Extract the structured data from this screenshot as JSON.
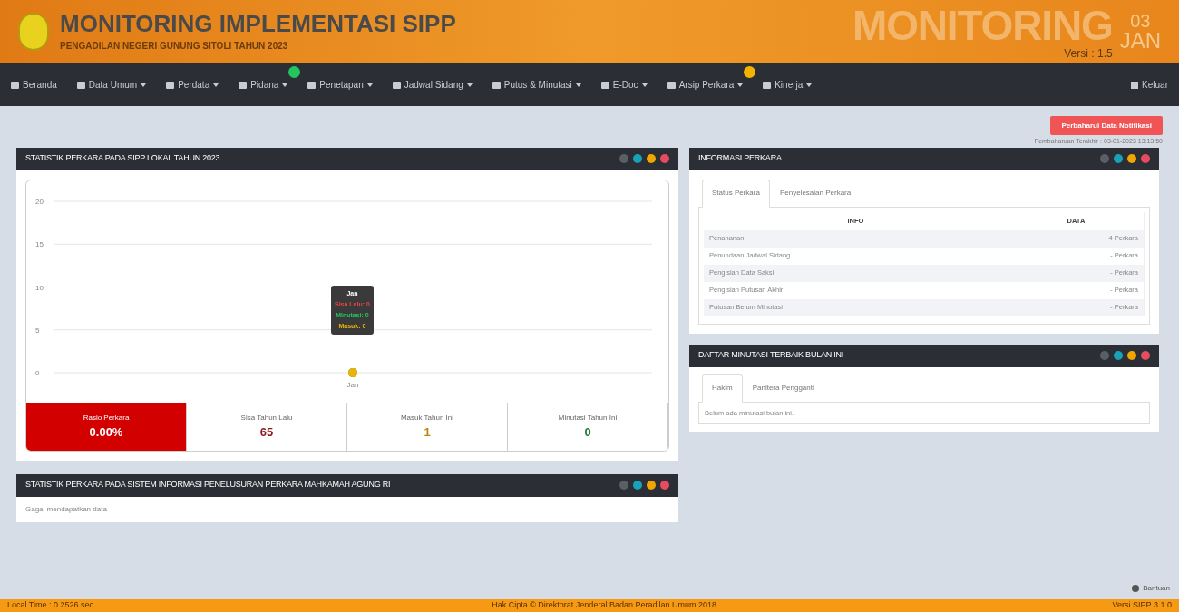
{
  "header": {
    "title": "MONITORING IMPLEMENTASI SIPP",
    "subtitle": "PENGADILAN NEGERI GUNUNG SITOLI TAHUN 2023",
    "banner": "MONITORING",
    "day": "03",
    "month": "JAN",
    "version": "Versi : 1.5"
  },
  "nav": {
    "items": [
      {
        "label": "Beranda",
        "dropdown": false
      },
      {
        "label": "Data Umum",
        "dropdown": true
      },
      {
        "label": "Perdata",
        "dropdown": true
      },
      {
        "label": "Pidana",
        "dropdown": true,
        "color": "#22c55e"
      },
      {
        "label": "Penetapan",
        "dropdown": true
      },
      {
        "label": "Jadwal Sidang",
        "dropdown": true
      },
      {
        "label": "Putus & Minutasi",
        "dropdown": true
      },
      {
        "label": "E-Doc",
        "dropdown": true
      },
      {
        "label": "Arsip Perkara",
        "dropdown": true,
        "color": "#f5b301"
      },
      {
        "label": "Kinerja",
        "dropdown": true
      }
    ],
    "logout": "Keluar"
  },
  "update_button": "Perbaharui Data Notifikasi",
  "last_update": "Pembaharuan Terakhir : 03-01-2023 13:13:50",
  "stat_panel": {
    "title": "STATISTIK PERKARA PADA SIPP LOKAL TAHUN 2023",
    "chart_data": {
      "type": "line",
      "categories": [
        "Jan"
      ],
      "yticks": [
        0,
        5,
        10,
        15,
        20
      ],
      "ylim": [
        0,
        20
      ],
      "grid": true,
      "series": [
        {
          "color": "#ef4444",
          "values": [
            0
          ],
          "marker": true
        },
        {
          "color": "#22c55e",
          "values": [
            0
          ],
          "marker": true
        },
        {
          "color": "#eab308",
          "values": [
            0
          ],
          "marker": true
        }
      ]
    },
    "tooltip": {
      "title": "Jan",
      "lines": [
        "Sisa Lalu: 0",
        "Minutasi: 0",
        "Masuk: 0"
      ]
    },
    "stats": [
      {
        "label": "Rasio Perkara",
        "value": "0.00%",
        "highlight": true,
        "color": "#ffffff"
      },
      {
        "label": "Sisa Tahun Lalu",
        "value": "65",
        "highlight": false,
        "color": "#8b1a1a"
      },
      {
        "label": "Masuk Tahun Ini",
        "value": "1",
        "highlight": false,
        "color": "#b8860b"
      },
      {
        "label": "Minutasi Tahun Ini",
        "value": "0",
        "highlight": false,
        "color": "#1f7a3a"
      }
    ]
  },
  "sipp_panel": {
    "title": "STATISTIK PERKARA PADA SISTEM INFORMASI PENELUSURAN PERKARA MAHKAMAH AGUNG RI",
    "message": "Gagal mendapatkan data"
  },
  "info_panel": {
    "title": "INFORMASI PERKARA",
    "tabs": [
      {
        "label": "Status Perkara",
        "selected": true
      },
      {
        "label": "Penyelesaian Perkara",
        "selected": false
      }
    ],
    "columns": [
      "INFO",
      "DATA"
    ],
    "rows": [
      [
        "Penahanan",
        "4 Perkara"
      ],
      [
        "Penundaan Jadwal Sidang",
        "- Perkara"
      ],
      [
        "Pengisian Data Saksi",
        "- Perkara"
      ],
      [
        "Pengisian Putusan Akhir",
        "- Perkara"
      ],
      [
        "Putusan Belum Minutasi",
        "- Perkara"
      ]
    ]
  },
  "minutasi_panel": {
    "title": "DAFTAR MINUTASI TERBAIK BULAN INI",
    "tabs": [
      {
        "label": "Hakim",
        "selected": true
      },
      {
        "label": "Panitera Pengganti",
        "selected": false
      }
    ],
    "message": "Belum ada minutasi bulan ini."
  },
  "help": "Bantuan",
  "footer": {
    "left": "Local Time : 0.2526 sec.",
    "center": "Hak Cipta © Direktorat Jenderal Badan Peradilan Umum 2018",
    "right": "Versi SIPP 3.1.0"
  }
}
